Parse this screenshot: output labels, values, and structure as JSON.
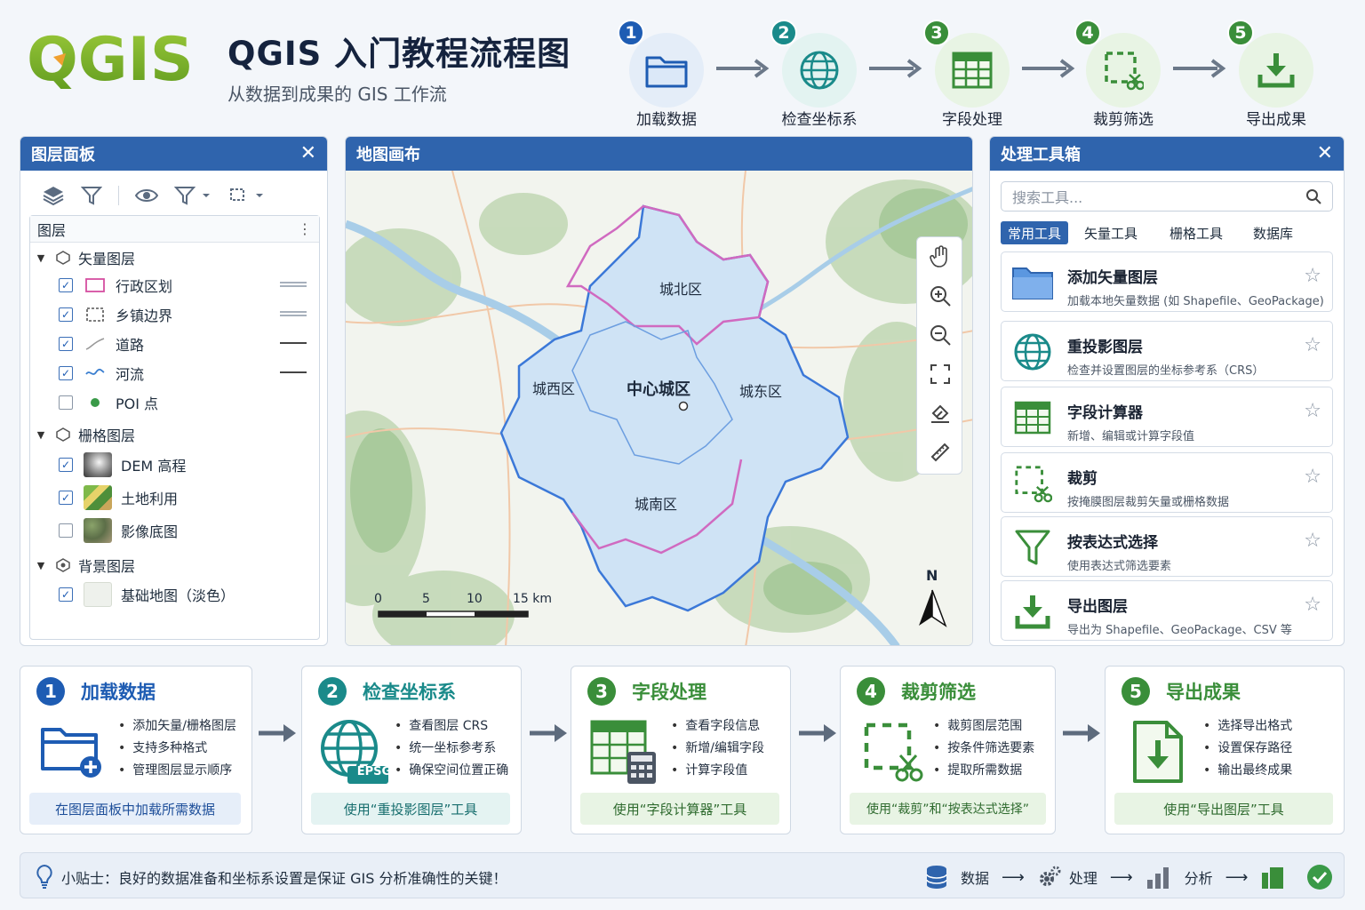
{
  "header": {
    "logo_text": "QGIS",
    "title": "QGIS 入门教程流程图",
    "subtitle": "从数据到成果的 GIS 工作流"
  },
  "steps": [
    {
      "num": "1",
      "label": "加载数据",
      "color": "#1e5cb3",
      "icon": "folder-icon"
    },
    {
      "num": "2",
      "label": "检查坐标系",
      "color": "#1a8a8a",
      "icon": "globe-icon"
    },
    {
      "num": "3",
      "label": "字段处理",
      "color": "#3a8e3a",
      "icon": "table-icon"
    },
    {
      "num": "4",
      "label": "裁剪筛选",
      "color": "#3a8e3a",
      "icon": "clip-icon"
    },
    {
      "num": "5",
      "label": "导出成果",
      "color": "#3a8e3a",
      "icon": "export-icon"
    }
  ],
  "layer_panel": {
    "title": "图层面板",
    "close": "✕",
    "header": "图层",
    "groups": [
      {
        "name": "矢量图层",
        "layers": [
          {
            "name": "行政区划",
            "checked": true
          },
          {
            "name": "乡镇边界",
            "checked": true
          },
          {
            "name": "道路",
            "checked": true
          },
          {
            "name": "河流",
            "checked": true
          },
          {
            "name": "POI 点",
            "checked": false
          }
        ]
      },
      {
        "name": "栅格图层",
        "layers": [
          {
            "name": "DEM 高程",
            "checked": true
          },
          {
            "name": "土地利用",
            "checked": true
          },
          {
            "name": "影像底图",
            "checked": false
          }
        ]
      },
      {
        "name": "背景图层",
        "layers": [
          {
            "name": "基础地图（淡色）",
            "checked": true
          }
        ]
      }
    ]
  },
  "map_panel": {
    "title": "地图画布",
    "districts": [
      "城北区",
      "城西区",
      "中心城区",
      "城东区",
      "城南区"
    ],
    "scale_ticks": [
      "0",
      "5",
      "10",
      "15 km"
    ],
    "north": "N"
  },
  "toolbox": {
    "title": "处理工具箱",
    "close": "✕",
    "search_placeholder": "搜索工具...",
    "tabs": [
      "常用工具",
      "矢量工具",
      "栅格工具",
      "数据库"
    ],
    "tools": [
      {
        "name": "添加矢量图层",
        "desc": "加载本地矢量数据 (如 Shapefile、GeoPackage)",
        "icon": "folder-icon"
      },
      {
        "name": "重投影图层",
        "desc": "检查并设置图层的坐标参考系（CRS）",
        "icon": "globe-icon"
      },
      {
        "name": "字段计算器",
        "desc": "新增、编辑或计算字段值",
        "icon": "table-icon"
      },
      {
        "name": "裁剪",
        "desc": "按掩膜图层裁剪矢量或栅格数据",
        "icon": "clip-icon"
      },
      {
        "name": "按表达式选择",
        "desc": "使用表达式筛选要素",
        "icon": "filter-icon"
      },
      {
        "name": "导出图层",
        "desc": "导出为 Shapefile、GeoPackage、CSV 等",
        "icon": "export-icon"
      }
    ]
  },
  "cards": [
    {
      "num": "1",
      "title": "加载数据",
      "color": "#1e5cb3",
      "bullets": [
        "添加矢量/栅格图层",
        "支持多种格式",
        "管理图层显示顺序"
      ],
      "footer": "在图层面板中加载所需数据",
      "footer_bg": "#e6eef9",
      "footer_color": "#1e4f9a"
    },
    {
      "num": "2",
      "title": "检查坐标系",
      "color": "#1a8a8a",
      "bullets": [
        "查看图层 CRS",
        "统一坐标参考系",
        "确保空间位置正确"
      ],
      "footer": "使用“重投影图层”工具",
      "footer_bg": "#e4f3f2",
      "footer_color": "#176e6e",
      "badge": "EPSG"
    },
    {
      "num": "3",
      "title": "字段处理",
      "color": "#3a8e3a",
      "bullets": [
        "查看字段信息",
        "新增/编辑字段",
        "计算字段值"
      ],
      "footer": "使用“字段计算器”工具",
      "footer_bg": "#e8f4e4",
      "footer_color": "#2f6b2f"
    },
    {
      "num": "4",
      "title": "裁剪筛选",
      "color": "#3a8e3a",
      "bullets": [
        "裁剪图层范围",
        "按条件筛选要素",
        "提取所需数据"
      ],
      "footer": "使用“裁剪”和“按表达式选择”",
      "footer_bg": "#e8f4e4",
      "footer_color": "#2f6b2f"
    },
    {
      "num": "5",
      "title": "导出成果",
      "color": "#3a8e3a",
      "bullets": [
        "选择导出格式",
        "设置保存路径",
        "输出最终成果"
      ],
      "footer": "使用“导出图层”工具",
      "footer_bg": "#e8f4e4",
      "footer_color": "#2f6b2f"
    }
  ],
  "tip": {
    "text": "小贴士：良好的数据准备和坐标系设置是保证 GIS 分析准确性的关键！",
    "flow": [
      "数据",
      "处理",
      "分析"
    ],
    "arrow": "⟶"
  }
}
